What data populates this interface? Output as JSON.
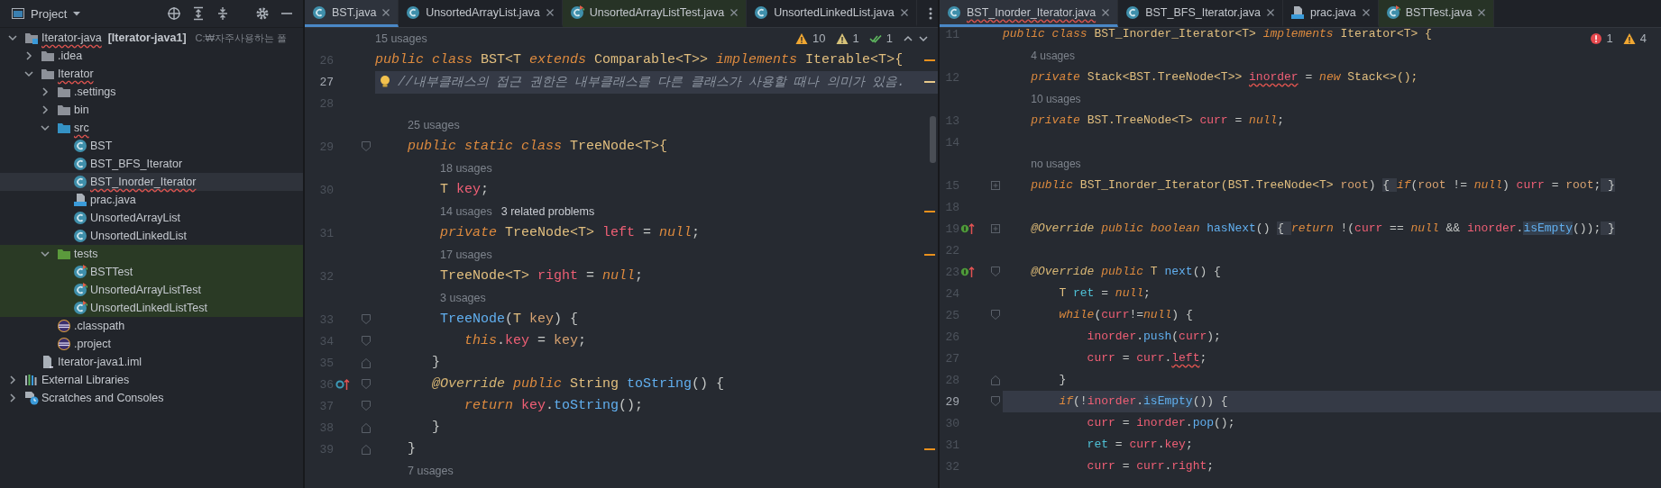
{
  "project_panel": {
    "title": "Project",
    "tree": [
      {
        "label": "Iterator-java",
        "module": "[Iterator-java1]",
        "path": "C:₩자주사용하는 폴",
        "kind": "module",
        "expanded": true,
        "selected": false,
        "error": true,
        "children": [
          {
            "label": ".idea",
            "kind": "folder",
            "expanded": false,
            "selected": false,
            "error": false
          },
          {
            "label": "Iterator",
            "kind": "folder",
            "expanded": true,
            "selected": false,
            "error": true,
            "children": [
              {
                "label": ".settings",
                "kind": "folder",
                "expanded": false,
                "selected": false,
                "error": false
              },
              {
                "label": "bin",
                "kind": "folder",
                "expanded": false,
                "selected": false,
                "error": false
              },
              {
                "label": "src",
                "kind": "source-folder",
                "expanded": true,
                "selected": false,
                "error": true,
                "children": [
                  {
                    "label": "BST",
                    "kind": "class",
                    "selected": false,
                    "error": false
                  },
                  {
                    "label": "BST_BFS_Iterator",
                    "kind": "class",
                    "selected": false,
                    "error": false
                  },
                  {
                    "label": "BST_Inorder_Iterator",
                    "kind": "class",
                    "selected": true,
                    "error": true
                  },
                  {
                    "label": "prac.java",
                    "kind": "java-file",
                    "selected": false,
                    "error": false
                  },
                  {
                    "label": "UnsortedArrayList",
                    "kind": "class",
                    "selected": false,
                    "error": false
                  },
                  {
                    "label": "UnsortedLinkedList",
                    "kind": "class",
                    "selected": false,
                    "error": false
                  }
                ]
              },
              {
                "label": "tests",
                "kind": "test-folder",
                "expanded": true,
                "selected": false,
                "error": false,
                "children": [
                  {
                    "label": "BSTTest",
                    "kind": "test-class",
                    "selected": false,
                    "error": false
                  },
                  {
                    "label": "UnsortedArrayListTest",
                    "kind": "test-class",
                    "selected": false,
                    "error": false
                  },
                  {
                    "label": "UnsortedLinkedListTest",
                    "kind": "test-class",
                    "selected": false,
                    "error": false
                  }
                ]
              },
              {
                "label": ".classpath",
                "kind": "eclipse-file",
                "selected": false,
                "error": false
              },
              {
                "label": ".project",
                "kind": "eclipse-file",
                "selected": false,
                "error": false
              }
            ]
          },
          {
            "label": "Iterator-java1.iml",
            "kind": "iml-file",
            "selected": false,
            "error": false
          }
        ]
      },
      {
        "label": "External Libraries",
        "kind": "libraries",
        "expanded": false,
        "selected": false,
        "error": false
      },
      {
        "label": "Scratches and Consoles",
        "kind": "scratches",
        "expanded": false,
        "selected": false,
        "error": false
      }
    ]
  },
  "editors": [
    {
      "tab_overflow_menu": true,
      "scrollbar": true,
      "nav_arrows": true,
      "tabs": [
        {
          "label": "BST.java",
          "kind": "class",
          "selected": true,
          "error": false
        },
        {
          "label": "UnsortedArrayList.java",
          "kind": "class",
          "selected": false,
          "error": false
        },
        {
          "label": "UnsortedArrayListTest.java",
          "kind": "test-class",
          "selected": false,
          "error": false
        },
        {
          "label": "UnsortedLinkedList.java",
          "kind": "class",
          "selected": false,
          "error": false
        }
      ],
      "inspections": [
        {
          "kind": "warning",
          "count": "10"
        },
        {
          "kind": "weak-warning",
          "count": "1"
        },
        {
          "kind": "typo",
          "count": "1"
        }
      ],
      "lines": [
        {
          "kind": "hint",
          "hints": [
            {
              "kind": "usages",
              "text": "15 usages"
            }
          ]
        },
        {
          "kind": "code",
          "number": "26",
          "current": false,
          "stripe": {
            "kind": "warning"
          },
          "tokens": [
            {
              "kind": "kw",
              "text": "public class "
            },
            {
              "kind": "type",
              "text": "BST<T "
            },
            {
              "kind": "kw",
              "text": "extends"
            },
            {
              "kind": "type",
              "text": " Comparable<T>> "
            },
            {
              "kind": "kw",
              "text": "implements"
            },
            {
              "kind": "type",
              "text": " Iterable<T>{"
            }
          ]
        },
        {
          "kind": "code",
          "number": "27",
          "current": true,
          "intention": {
            "kind": "bulb"
          },
          "stripe": {
            "kind": "weak"
          },
          "tokens": [
            {
              "kind": "comment",
              "text": "   //내부클래스의 접근 권한은 내부클래스를 다른 클래스가 사용할 때나 의미가 있음."
            }
          ]
        },
        {
          "kind": "code",
          "number": "28",
          "current": false
        },
        {
          "kind": "hint",
          "hints": [
            {
              "kind": "usages",
              "text": "    25 usages"
            }
          ]
        },
        {
          "kind": "code",
          "number": "29",
          "current": false,
          "fold": {
            "kind": "open"
          },
          "tokens": [
            {
              "kind": "kw",
              "text": "    public static class "
            },
            {
              "kind": "type",
              "text": "TreeNode<T>{"
            }
          ]
        },
        {
          "kind": "hint",
          "hints": [
            {
              "kind": "usages",
              "text": "        18 usages"
            }
          ]
        },
        {
          "kind": "code",
          "number": "30",
          "current": false,
          "tokens": [
            {
              "kind": "type",
              "text": "        T "
            },
            {
              "kind": "field",
              "text": "key"
            },
            {
              "kind": "plain",
              "text": ";"
            }
          ]
        },
        {
          "kind": "hint",
          "stripe": {
            "kind": "warning"
          },
          "hints": [
            {
              "kind": "usages",
              "text": "        14 usages"
            },
            {
              "kind": "problems",
              "text": "3 related problems"
            }
          ]
        },
        {
          "kind": "code",
          "number": "31",
          "current": false,
          "tokens": [
            {
              "kind": "kw",
              "text": "        private "
            },
            {
              "kind": "type",
              "text": "TreeNode<T> "
            },
            {
              "kind": "field",
              "text": "left"
            },
            {
              "kind": "plain",
              "text": " = "
            },
            {
              "kind": "kw",
              "text": "null"
            },
            {
              "kind": "plain",
              "text": ";"
            }
          ]
        },
        {
          "kind": "hint",
          "stripe": {
            "kind": "warning"
          },
          "hints": [
            {
              "kind": "usages",
              "text": "        17 usages"
            }
          ]
        },
        {
          "kind": "code",
          "number": "32",
          "current": false,
          "tokens": [
            {
              "kind": "type",
              "text": "        TreeNode<T> "
            },
            {
              "kind": "field",
              "text": "right"
            },
            {
              "kind": "plain",
              "text": " = "
            },
            {
              "kind": "kw",
              "text": "null"
            },
            {
              "kind": "plain",
              "text": ";"
            }
          ]
        },
        {
          "kind": "hint",
          "hints": [
            {
              "kind": "usages",
              "text": "        3 usages"
            }
          ]
        },
        {
          "kind": "code",
          "number": "33",
          "current": false,
          "fold": {
            "kind": "open"
          },
          "tokens": [
            {
              "kind": "method",
              "text": "        TreeNode"
            },
            {
              "kind": "plain",
              "text": "("
            },
            {
              "kind": "type",
              "text": "T "
            },
            {
              "kind": "param",
              "text": "key"
            },
            {
              "kind": "plain",
              "text": ") {"
            }
          ]
        },
        {
          "kind": "code",
          "number": "34",
          "current": false,
          "fold": {
            "kind": "open"
          },
          "tokens": [
            {
              "kind": "kw",
              "text": "           this"
            },
            {
              "kind": "plain",
              "text": "."
            },
            {
              "kind": "field",
              "text": "key"
            },
            {
              "kind": "plain",
              "text": " = "
            },
            {
              "kind": "param",
              "text": "key"
            },
            {
              "kind": "plain",
              "text": ";"
            }
          ]
        },
        {
          "kind": "code",
          "number": "35",
          "current": false,
          "fold": {
            "kind": "close"
          },
          "tokens": [
            {
              "kind": "plain",
              "text": "       }"
            }
          ]
        },
        {
          "kind": "code",
          "number": "36",
          "current": false,
          "fold": {
            "kind": "open"
          },
          "marker": {
            "kind": "override"
          },
          "tokens": [
            {
              "kind": "anno",
              "text": "       @Override"
            },
            {
              "kind": "kw",
              "text": " public "
            },
            {
              "kind": "type",
              "text": "String "
            },
            {
              "kind": "method",
              "text": "toString"
            },
            {
              "kind": "plain",
              "text": "() {"
            }
          ]
        },
        {
          "kind": "code",
          "number": "37",
          "current": false,
          "fold": {
            "kind": "open"
          },
          "tokens": [
            {
              "kind": "kw",
              "text": "           return "
            },
            {
              "kind": "field",
              "text": "key"
            },
            {
              "kind": "plain",
              "text": "."
            },
            {
              "kind": "method",
              "text": "toString"
            },
            {
              "kind": "plain",
              "text": "();"
            }
          ]
        },
        {
          "kind": "code",
          "number": "38",
          "current": false,
          "fold": {
            "kind": "close"
          },
          "tokens": [
            {
              "kind": "plain",
              "text": "       }"
            }
          ]
        },
        {
          "kind": "code",
          "number": "39",
          "current": false,
          "fold": {
            "kind": "close"
          },
          "stripe": {
            "kind": "warning"
          },
          "tokens": [
            {
              "kind": "plain",
              "text": "    }"
            }
          ]
        },
        {
          "kind": "hint",
          "hints": [
            {
              "kind": "usages",
              "text": "    7 usages"
            }
          ]
        }
      ]
    },
    {
      "tab_overflow_menu": false,
      "scrollbar": false,
      "nav_arrows": false,
      "tabs": [
        {
          "label": "BST_Inorder_Iterator.java",
          "kind": "class",
          "selected": true,
          "error": true
        },
        {
          "label": "BST_BFS_Iterator.java",
          "kind": "class",
          "selected": false,
          "error": false
        },
        {
          "label": "prac.java",
          "kind": "java-file",
          "selected": false,
          "error": false
        },
        {
          "label": "BSTTest.java",
          "kind": "test-class",
          "selected": false,
          "error": false
        }
      ],
      "inspections": [
        {
          "kind": "error",
          "count": "1"
        },
        {
          "kind": "warning",
          "count": "4"
        }
      ],
      "lines": [
        {
          "kind": "code",
          "number": "11",
          "current": false,
          "tokens": [
            {
              "kind": "kw",
              "text": "public class "
            },
            {
              "kind": "type",
              "text": "BST_Inorder_Iterator<T> "
            },
            {
              "kind": "kw",
              "text": "implements"
            },
            {
              "kind": "type",
              "text": " Iterator<T> {"
            }
          ]
        },
        {
          "kind": "hint",
          "hints": [
            {
              "kind": "usages",
              "text": "    4 usages"
            }
          ]
        },
        {
          "kind": "code",
          "number": "12",
          "current": false,
          "tokens": [
            {
              "kind": "kw",
              "text": "    private "
            },
            {
              "kind": "type",
              "text": "Stack<BST.TreeNode<T>> "
            },
            {
              "kind": "error_field",
              "text": "inorder"
            },
            {
              "kind": "plain",
              "text": " = "
            },
            {
              "kind": "kw",
              "text": "new"
            },
            {
              "kind": "type",
              "text": " Stack<>();"
            }
          ]
        },
        {
          "kind": "hint",
          "hints": [
            {
              "kind": "usages",
              "text": "    10 usages"
            }
          ]
        },
        {
          "kind": "code",
          "number": "13",
          "current": false,
          "tokens": [
            {
              "kind": "kw",
              "text": "    private "
            },
            {
              "kind": "type",
              "text": "BST.TreeNode<T> "
            },
            {
              "kind": "field",
              "text": "curr"
            },
            {
              "kind": "plain",
              "text": " = "
            },
            {
              "kind": "kw",
              "text": "null"
            },
            {
              "kind": "plain",
              "text": ";"
            }
          ]
        },
        {
          "kind": "code",
          "number": "14",
          "current": false
        },
        {
          "kind": "hint",
          "hints": [
            {
              "kind": "usages",
              "text": "    no usages"
            }
          ]
        },
        {
          "kind": "code",
          "number": "15",
          "current": false,
          "fold": {
            "kind": "expand"
          },
          "tokens": [
            {
              "kind": "kw",
              "text": "    public "
            },
            {
              "kind": "type",
              "text": "BST_Inorder_Iterator(BST.TreeNode<T> "
            },
            {
              "kind": "param",
              "text": "root"
            },
            {
              "kind": "plain",
              "text": ") "
            },
            {
              "kind": "fold",
              "text": "{ "
            },
            {
              "kind": "kw",
              "text": "if"
            },
            {
              "kind": "plain",
              "text": "("
            },
            {
              "kind": "param",
              "text": "root"
            },
            {
              "kind": "plain",
              "text": " != "
            },
            {
              "kind": "kw",
              "text": "null"
            },
            {
              "kind": "plain",
              "text": ") "
            },
            {
              "kind": "field",
              "text": "curr"
            },
            {
              "kind": "plain",
              "text": " = "
            },
            {
              "kind": "param",
              "text": "root"
            },
            {
              "kind": "plain",
              "text": ";"
            },
            {
              "kind": "fold",
              "text": " }"
            }
          ]
        },
        {
          "kind": "code",
          "number": "18",
          "current": false
        },
        {
          "kind": "code",
          "number": "19",
          "current": false,
          "fold": {
            "kind": "expand"
          },
          "marker": {
            "kind": "implement"
          },
          "tokens": [
            {
              "kind": "anno",
              "text": "    @Override"
            },
            {
              "kind": "kw",
              "text": " public boolean "
            },
            {
              "kind": "method",
              "text": "hasNext"
            },
            {
              "kind": "plain",
              "text": "() "
            },
            {
              "kind": "fold",
              "text": "{ "
            },
            {
              "kind": "kw",
              "text": "return"
            },
            {
              "kind": "plain",
              "text": " !("
            },
            {
              "kind": "field",
              "text": "curr"
            },
            {
              "kind": "plain",
              "text": " == "
            },
            {
              "kind": "kw",
              "text": "null"
            },
            {
              "kind": "plain",
              "text": " && "
            },
            {
              "kind": "field",
              "text": "inorder"
            },
            {
              "kind": "plain",
              "text": "."
            },
            {
              "kind": "method_hl",
              "text": "isEmpty"
            },
            {
              "kind": "plain",
              "text": "());"
            },
            {
              "kind": "fold",
              "text": " }"
            }
          ]
        },
        {
          "kind": "code",
          "number": "22",
          "current": false
        },
        {
          "kind": "code",
          "number": "23",
          "current": false,
          "fold": {
            "kind": "open"
          },
          "marker": {
            "kind": "implement"
          },
          "tokens": [
            {
              "kind": "anno",
              "text": "    @Override"
            },
            {
              "kind": "kw",
              "text": " public "
            },
            {
              "kind": "type",
              "text": "T "
            },
            {
              "kind": "method",
              "text": "next"
            },
            {
              "kind": "plain",
              "text": "() {"
            }
          ]
        },
        {
          "kind": "code",
          "number": "24",
          "current": false,
          "tokens": [
            {
              "kind": "type",
              "text": "        T "
            },
            {
              "kind": "local",
              "text": "ret"
            },
            {
              "kind": "plain",
              "text": " = "
            },
            {
              "kind": "kw",
              "text": "null"
            },
            {
              "kind": "plain",
              "text": ";"
            }
          ]
        },
        {
          "kind": "code",
          "number": "25",
          "current": false,
          "fold": {
            "kind": "open"
          },
          "tokens": [
            {
              "kind": "kw",
              "text": "        while"
            },
            {
              "kind": "plain",
              "text": "("
            },
            {
              "kind": "field",
              "text": "curr"
            },
            {
              "kind": "plain",
              "text": "!="
            },
            {
              "kind": "kw",
              "text": "null"
            },
            {
              "kind": "plain",
              "text": ") {"
            }
          ]
        },
        {
          "kind": "code",
          "number": "26",
          "current": false,
          "tokens": [
            {
              "kind": "field",
              "text": "            inorder"
            },
            {
              "kind": "plain",
              "text": "."
            },
            {
              "kind": "method",
              "text": "push"
            },
            {
              "kind": "plain",
              "text": "("
            },
            {
              "kind": "field",
              "text": "curr"
            },
            {
              "kind": "plain",
              "text": ");"
            }
          ]
        },
        {
          "kind": "code",
          "number": "27",
          "current": false,
          "tokens": [
            {
              "kind": "field",
              "text": "            curr"
            },
            {
              "kind": "plain",
              "text": " = "
            },
            {
              "kind": "field",
              "text": "curr"
            },
            {
              "kind": "plain",
              "text": "."
            },
            {
              "kind": "error_field",
              "text": "left"
            },
            {
              "kind": "plain",
              "text": ";"
            }
          ]
        },
        {
          "kind": "code",
          "number": "28",
          "current": false,
          "fold": {
            "kind": "close"
          },
          "tokens": [
            {
              "kind": "plain",
              "text": "        }"
            }
          ]
        },
        {
          "kind": "code",
          "number": "29",
          "current": true,
          "fold": {
            "kind": "open"
          },
          "tokens": [
            {
              "kind": "kw",
              "text": "        if"
            },
            {
              "kind": "plain",
              "text": "(!"
            },
            {
              "kind": "field",
              "text": "inorder"
            },
            {
              "kind": "plain",
              "text": "."
            },
            {
              "kind": "method_hl",
              "text": "isEmpty"
            },
            {
              "kind": "plain",
              "text": "()) {"
            }
          ]
        },
        {
          "kind": "code",
          "number": "30",
          "current": false,
          "tokens": [
            {
              "kind": "field",
              "text": "            curr"
            },
            {
              "kind": "plain",
              "text": " = "
            },
            {
              "kind": "field",
              "text": "inorder"
            },
            {
              "kind": "plain",
              "text": "."
            },
            {
              "kind": "method",
              "text": "pop"
            },
            {
              "kind": "plain",
              "text": "();"
            }
          ]
        },
        {
          "kind": "code",
          "number": "31",
          "current": false,
          "tokens": [
            {
              "kind": "local",
              "text": "            ret"
            },
            {
              "kind": "plain",
              "text": " = "
            },
            {
              "kind": "field",
              "text": "curr"
            },
            {
              "kind": "plain",
              "text": "."
            },
            {
              "kind": "field",
              "text": "key"
            },
            {
              "kind": "plain",
              "text": ";"
            }
          ]
        },
        {
          "kind": "code",
          "number": "32",
          "current": false,
          "tokens": [
            {
              "kind": "field",
              "text": "            curr"
            },
            {
              "kind": "plain",
              "text": " = "
            },
            {
              "kind": "field",
              "text": "curr"
            },
            {
              "kind": "plain",
              "text": "."
            },
            {
              "kind": "field",
              "text": "right"
            },
            {
              "kind": "plain",
              "text": ";"
            }
          ]
        }
      ]
    }
  ]
}
